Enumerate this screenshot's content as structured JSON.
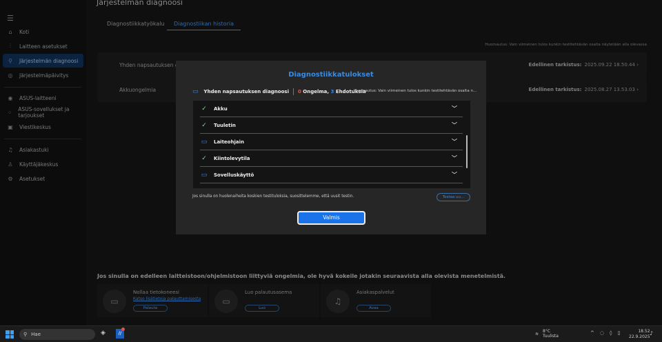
{
  "sidebar": {
    "items": [
      {
        "label": "Koti",
        "icon": "home-icon"
      },
      {
        "label": "Laitteen asetukset",
        "icon": "sliders-icon"
      },
      {
        "label": "Järjestelmän diagnoosi",
        "icon": "diagnosis-icon",
        "active": true
      },
      {
        "label": "Järjestelmäpäivitys",
        "icon": "update-icon"
      },
      {
        "label": "ASUS-laitteeni",
        "icon": "devices-icon"
      },
      {
        "label": "ASUS-sovellukset ja tarjoukset",
        "icon": "apps-icon"
      },
      {
        "label": "Viestikeskus",
        "icon": "message-icon"
      },
      {
        "label": "Asiakastuki",
        "icon": "headset-icon"
      },
      {
        "label": "Käyttäjäkeskus",
        "icon": "user-icon"
      },
      {
        "label": "Asetukset",
        "icon": "gear-icon"
      }
    ]
  },
  "page": {
    "title": "Järjestelmän diagnoosi",
    "tabs": [
      {
        "label": "Diagnostiikkatyökalu"
      },
      {
        "label": "Diagnostiikan historia",
        "active": true
      }
    ],
    "note": "Huomautus: Vain viimeinen tulos kunkin testitehtävän osalta näytetään alla olevassa",
    "history": [
      {
        "name": "Yhden napsautuksen diagnoosi",
        "last_label": "Edellinen tarkistus:",
        "last_value": "2025.09.22 18.50.44"
      },
      {
        "name": "Akkuongelmia",
        "last_label": "Edellinen tarkistus:",
        "last_value": "2025.08.27 13.53.03"
      }
    ],
    "bottom_title": "Jos sinulla on edelleen laitteistoon/ohjelmistoon liittyviä ongelmia, ole hyvä kokeile jotakin seuraavista alla olevista menetelmistä.",
    "options": [
      {
        "title": "Nollaa tietokoneesi",
        "link": "Katso lisätietoja palauttamisesta",
        "button": "Palauta"
      },
      {
        "title": "Luo palautusasema",
        "link": "",
        "button": "Luo"
      },
      {
        "title": "Asiakaspalvelut",
        "link": "",
        "button": "Avaa"
      }
    ]
  },
  "modal": {
    "title": "Diagnostiikkatulokset",
    "summary_name": "Yhden napsautuksen diagnoosi",
    "problems_count": "0",
    "problems_label": "Ongelma,",
    "suggestions_count": "3",
    "suggestions_label": "Ehdotuksia",
    "note": "Huomautus: Vain viimeinen tulos kunkin testitehtävän osalta n...",
    "items": [
      {
        "label": "Akku",
        "status": "ok"
      },
      {
        "label": "Tuuletin",
        "status": "ok"
      },
      {
        "label": "Laiteohjain",
        "status": "suggestion"
      },
      {
        "label": "Kiintolevytila",
        "status": "ok"
      },
      {
        "label": "Sovelluskäyttö",
        "status": "suggestion"
      }
    ],
    "concern_text": "Jos sinulla on huolenaiheita koskien testituloksia, suosittelemme, että uusit testin.",
    "retest_button": "Testaa uu...",
    "done_button": "Valmis"
  },
  "taskbar": {
    "search_placeholder": "Hae",
    "weather_temp": "8°C",
    "weather_desc": "Tuulista",
    "time": "18.52",
    "date": "22.9.2025"
  },
  "colors": {
    "accent": "#1a73e8",
    "problem": "#e05545"
  }
}
